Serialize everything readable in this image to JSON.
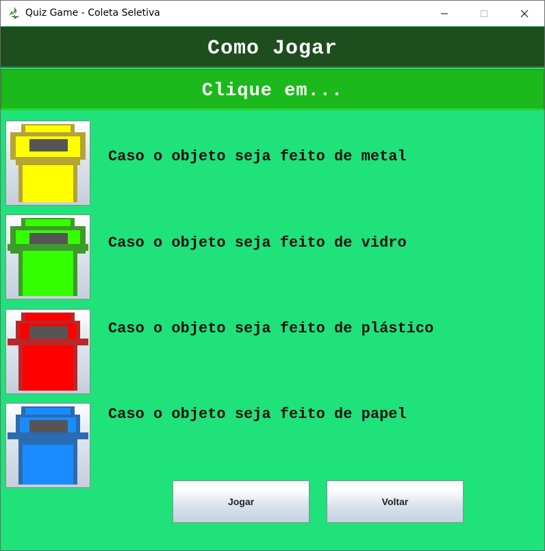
{
  "window": {
    "title": "Quiz Game - Coleta Seletiva",
    "icon": "recycle-icon",
    "controls": [
      "minimize-icon",
      "maximize-icon",
      "close-icon"
    ]
  },
  "header": {
    "title": "Como Jogar",
    "subtitle": "Clique em..."
  },
  "bins": [
    {
      "label": "Caso o objeto seja feito de metal",
      "icon": "yellow-bin-icon",
      "color": "#ffff00",
      "rim": "#b5a434"
    },
    {
      "label": "Caso o objeto seja feito de vidro",
      "icon": "green-bin-icon",
      "color": "#33ff00",
      "rim": "#3e9a2a"
    },
    {
      "label": "Caso o objeto seja feito de plástico",
      "icon": "red-bin-icon",
      "color": "#ff0000",
      "rim": "#b82828"
    },
    {
      "label": "Caso o objeto seja feito de papel",
      "icon": "blue-bin-icon",
      "color": "#1a8cff",
      "rim": "#2b6bb0"
    }
  ],
  "buttons": {
    "play": "Jogar",
    "back": "Voltar"
  },
  "colors": {
    "background": "#1fe27a",
    "header_dark": "#1e4d1e",
    "header_light": "#1bb91b"
  }
}
